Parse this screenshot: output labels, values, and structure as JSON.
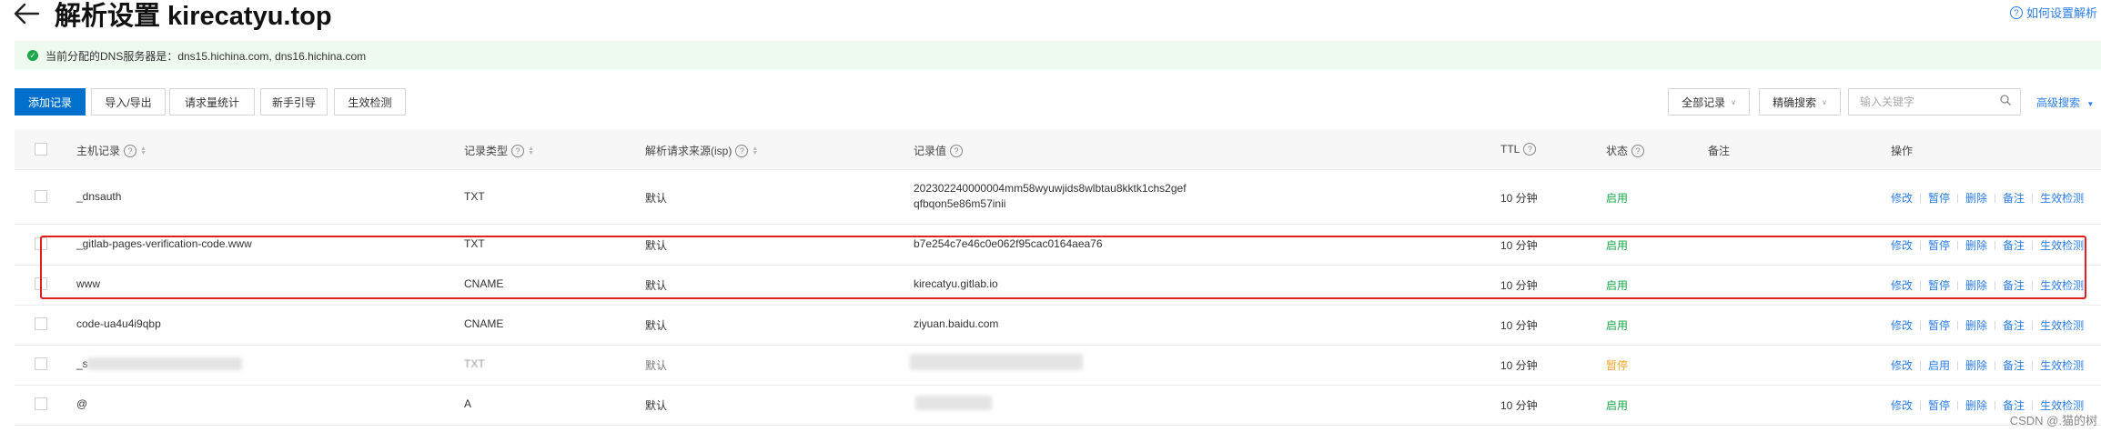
{
  "header": {
    "title": "解析设置 kirecatyu.top",
    "help_link": "如何设置解析"
  },
  "banner": {
    "text": "当前分配的DNS服务器是：dns15.hichina.com, dns16.hichina.com"
  },
  "toolbar": {
    "buttons": [
      "添加记录",
      "导入/导出",
      "请求量统计",
      "新手引导",
      "生效检测"
    ],
    "scope_select": "全部记录",
    "match_select": "精确搜索",
    "search_placeholder": "输入关键字",
    "advanced_search": "高级搜索"
  },
  "table": {
    "columns": {
      "host": "主机记录",
      "type": "记录类型",
      "isp": "解析请求来源(isp)",
      "value": "记录值",
      "ttl": "TTL",
      "status": "状态",
      "remark": "备注",
      "ops": "操作"
    },
    "rows": [
      {
        "host": "_dnsauth",
        "type": "TXT",
        "isp": "默认",
        "value": "202302240000004mm58wyuwjids8wlbtau8kktk1chs2gef\nqfbqon5e86m57inii",
        "ttl": "10 分钟",
        "status": "启用",
        "ops": [
          "修改",
          "暂停",
          "删除",
          "备注",
          "生效检测"
        ]
      },
      {
        "host": "_gitlab-pages-verification-code.www",
        "type": "TXT",
        "isp": "默认",
        "value": "b7e254c7e46c0e062f95cac0164aea76",
        "ttl": "10 分钟",
        "status": "启用",
        "ops": [
          "修改",
          "暂停",
          "删除",
          "备注",
          "生效检测"
        ]
      },
      {
        "host": "www",
        "type": "CNAME",
        "isp": "默认",
        "value": "kirecatyu.gitlab.io",
        "ttl": "10 分钟",
        "status": "启用",
        "ops": [
          "修改",
          "暂停",
          "删除",
          "备注",
          "生效检测"
        ]
      },
      {
        "host": "code-ua4u4i9qbp",
        "type": "CNAME",
        "isp": "默认",
        "value": "ziyuan.baidu.com",
        "ttl": "10 分钟",
        "status": "启用",
        "ops": [
          "修改",
          "暂停",
          "删除",
          "备注",
          "生效检测"
        ]
      },
      {
        "host": "_s",
        "type": "TXT",
        "isp": "默认",
        "value": "",
        "ttl": "10 分钟",
        "status": "暂停",
        "ops": [
          "修改",
          "启用",
          "删除",
          "备注",
          "生效检测"
        ]
      },
      {
        "host": "@",
        "type": "A",
        "isp": "默认",
        "value": "",
        "ttl": "10 分钟",
        "status": "启用",
        "ops": [
          "修改",
          "暂停",
          "删除",
          "备注",
          "生效检测"
        ]
      }
    ]
  },
  "watermark": "CSDN @.猫的树",
  "colors": {
    "primary": "#0070cc",
    "link": "#2b7de9",
    "enabled": "#1aa84a",
    "paused": "#f5a623",
    "highlight": "#e02020",
    "banner_bg": "#eefaf0"
  }
}
